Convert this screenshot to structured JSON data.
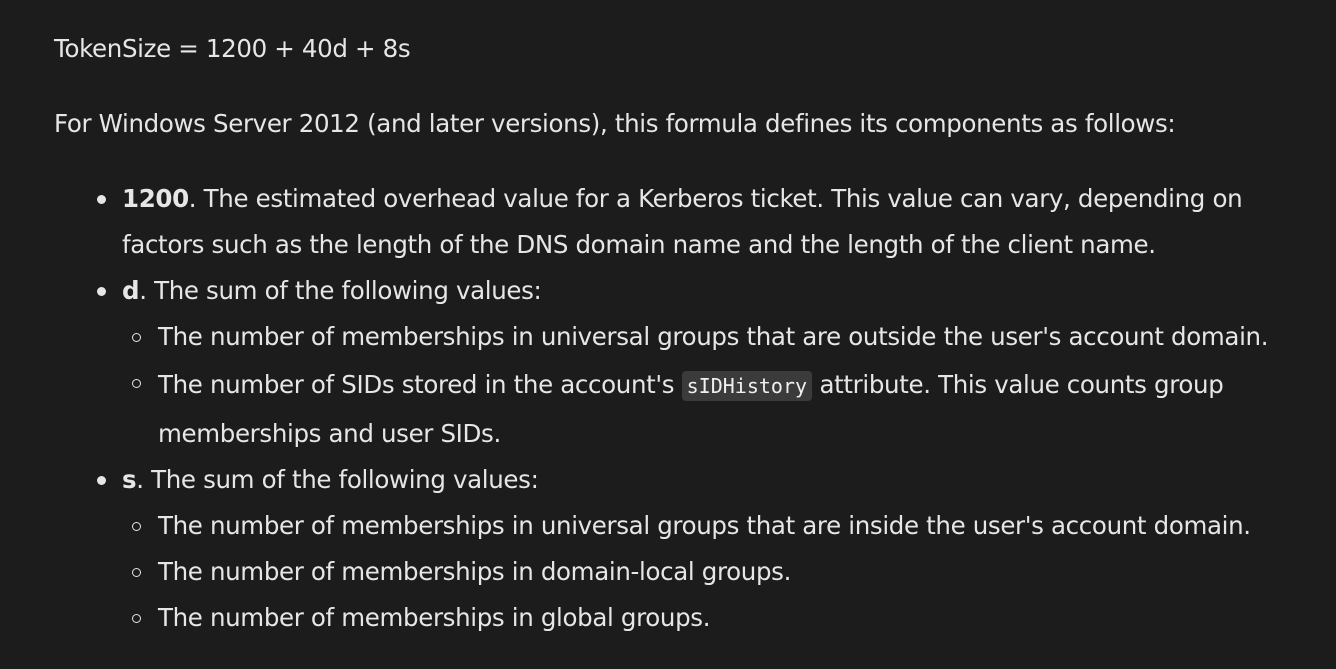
{
  "formula": "TokenSize = 1200 + 40d + 8s",
  "intro": "For Windows Server 2012 (and later versions), this formula defines its components as follows:",
  "items": [
    {
      "term": "1200",
      "text": ". The estimated overhead value for a Kerberos ticket. This value can vary, depending on",
      "text_cont": "factors such as the length of the DNS domain name and the length of the client name."
    },
    {
      "term": "d",
      "text": ". The sum of the following values:",
      "sub": [
        "The number of memberships in universal groups that are outside the user's account domain.",
        {
          "before": "The number of SIDs stored in the account's ",
          "code": "sIDHistory",
          "after": " attribute. This value counts group",
          "cont": "memberships and user SIDs."
        }
      ]
    },
    {
      "term": "s",
      "text": ". The sum of the following values:",
      "sub": [
        "The number of memberships in universal groups that are inside the user's account domain.",
        "The number of memberships in domain-local groups.",
        "The number of memberships in global groups."
      ]
    }
  ]
}
